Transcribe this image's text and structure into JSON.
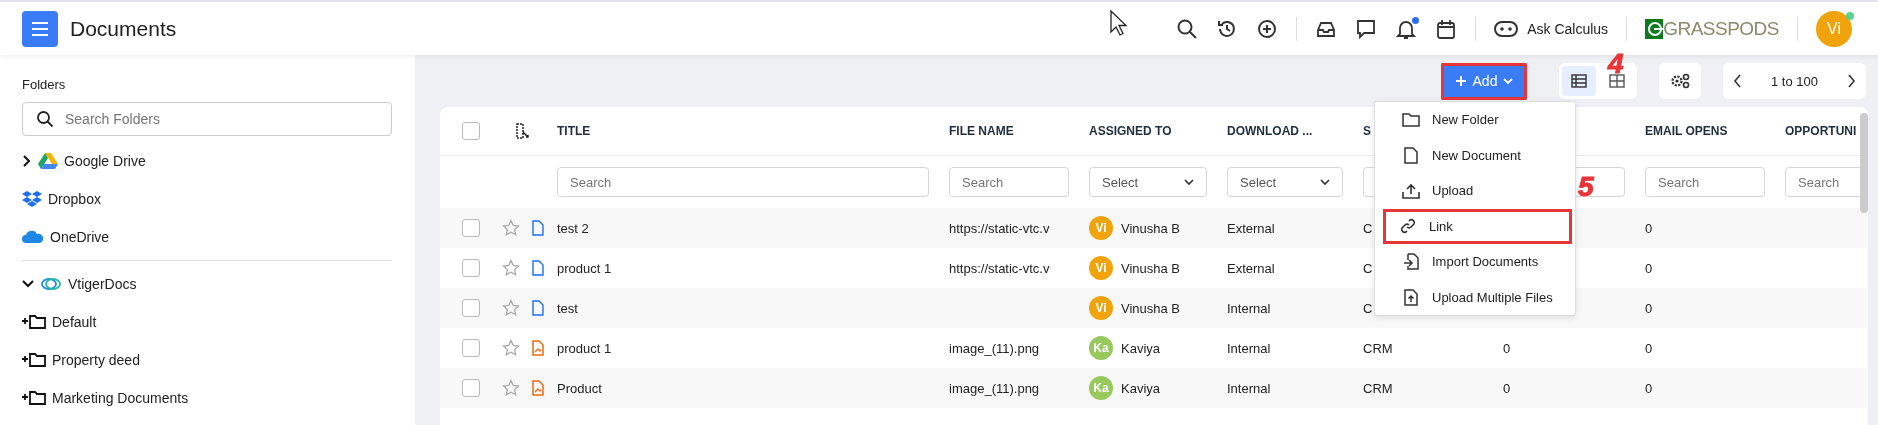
{
  "header": {
    "title": "Documents",
    "notifications": {
      "unread": true
    },
    "assistant": {
      "label": "Ask Calculus"
    },
    "brand": {
      "text": "GRASSPODS"
    },
    "user": {
      "initials": "Vi",
      "online": true
    }
  },
  "sidebar": {
    "heading": "Folders",
    "search": {
      "placeholder": "Search Folders"
    },
    "storages": [
      {
        "label": "Google Drive",
        "kind": "drive",
        "expanded": false
      },
      {
        "label": "Dropbox",
        "kind": "box"
      },
      {
        "label": "OneDrive",
        "kind": "cloud"
      }
    ],
    "tree": [
      {
        "label": "VtigerDocs",
        "expanded": true,
        "children": [
          {
            "label": "Default"
          },
          {
            "label": "Property deed"
          },
          {
            "label": "Marketing Documents"
          }
        ]
      }
    ]
  },
  "toolbar": {
    "add_button": {
      "label": "Add",
      "highlighted": true,
      "step_marker": "4"
    },
    "views": [
      {
        "kind": "list",
        "selected": true
      },
      {
        "kind": "grid",
        "selected": false
      }
    ],
    "pager": {
      "range": "1 to 100"
    }
  },
  "add_menu": [
    {
      "kind": "folder",
      "label": "New Folder",
      "highlighted": false
    },
    {
      "kind": "document",
      "label": "New Document",
      "highlighted": false
    },
    {
      "kind": "upload",
      "label": "Upload",
      "highlighted": false
    },
    {
      "kind": "link",
      "label": "Link",
      "highlighted": true,
      "step_marker": "5"
    },
    {
      "kind": "import",
      "label": "Import Documents",
      "highlighted": false
    },
    {
      "kind": "multi-upload",
      "label": "Upload Multiple Files",
      "highlighted": false
    }
  ],
  "table": {
    "select_all": {
      "checked": false
    },
    "columns": [
      {
        "label": "TITLE",
        "filter": {
          "kind": "search",
          "placeholder": "Search"
        }
      },
      {
        "label": "FILE NAME",
        "filter": {
          "kind": "search",
          "placeholder": "Search"
        }
      },
      {
        "label": "ASSIGNED TO",
        "filter": {
          "kind": "select",
          "placeholder": "Select"
        }
      },
      {
        "label": "DOWNLOAD ...",
        "filter": {
          "kind": "select",
          "placeholder": "Select"
        }
      },
      {
        "label": "S",
        "filter": {
          "kind": "search"
        }
      },
      {
        "filter": {
          "kind": "search"
        }
      },
      {
        "label": "EMAIL OPENS",
        "filter": {
          "kind": "search",
          "placeholder": "Search"
        }
      },
      {
        "label": "OPPORTUNI",
        "filter": {
          "kind": "search",
          "placeholder": "Search"
        }
      }
    ],
    "rows": [
      {
        "checked": false,
        "starred": false,
        "kind": "document",
        "title": "test 2",
        "file_name": "https://static-vtc.v",
        "assigned_to": {
          "initials": "Vi",
          "name": "Vinusha B",
          "color": "#f0a30a"
        },
        "download": "External",
        "column_6": "C",
        "email_opens": "0"
      },
      {
        "checked": false,
        "starred": false,
        "kind": "document",
        "title": "product 1",
        "file_name": "https://static-vtc.v",
        "assigned_to": {
          "initials": "Vi",
          "name": "Vinusha B",
          "color": "#f0a30a"
        },
        "download": "External",
        "column_6": "C",
        "email_opens": "0"
      },
      {
        "checked": false,
        "starred": false,
        "kind": "document",
        "title": "test",
        "assigned_to": {
          "initials": "Vi",
          "name": "Vinusha B",
          "color": "#f0a30a"
        },
        "download": "Internal",
        "column_6": "C",
        "email_opens": "0"
      },
      {
        "checked": false,
        "starred": false,
        "kind": "image",
        "title": "product 1",
        "file_name": "image_(11).png",
        "assigned_to": {
          "initials": "Ka",
          "name": "Kaviya",
          "color": "#97c95c"
        },
        "download": "Internal",
        "column_6": "CRM",
        "column_7": "0",
        "email_opens": "0"
      },
      {
        "checked": false,
        "starred": false,
        "kind": "image",
        "title": "Product",
        "file_name": "image_(11).png",
        "assigned_to": {
          "initials": "Ka",
          "name": "Kaviya",
          "color": "#97c95c"
        },
        "download": "Internal",
        "column_6": "CRM",
        "column_7": "0",
        "email_opens": "0"
      }
    ]
  }
}
